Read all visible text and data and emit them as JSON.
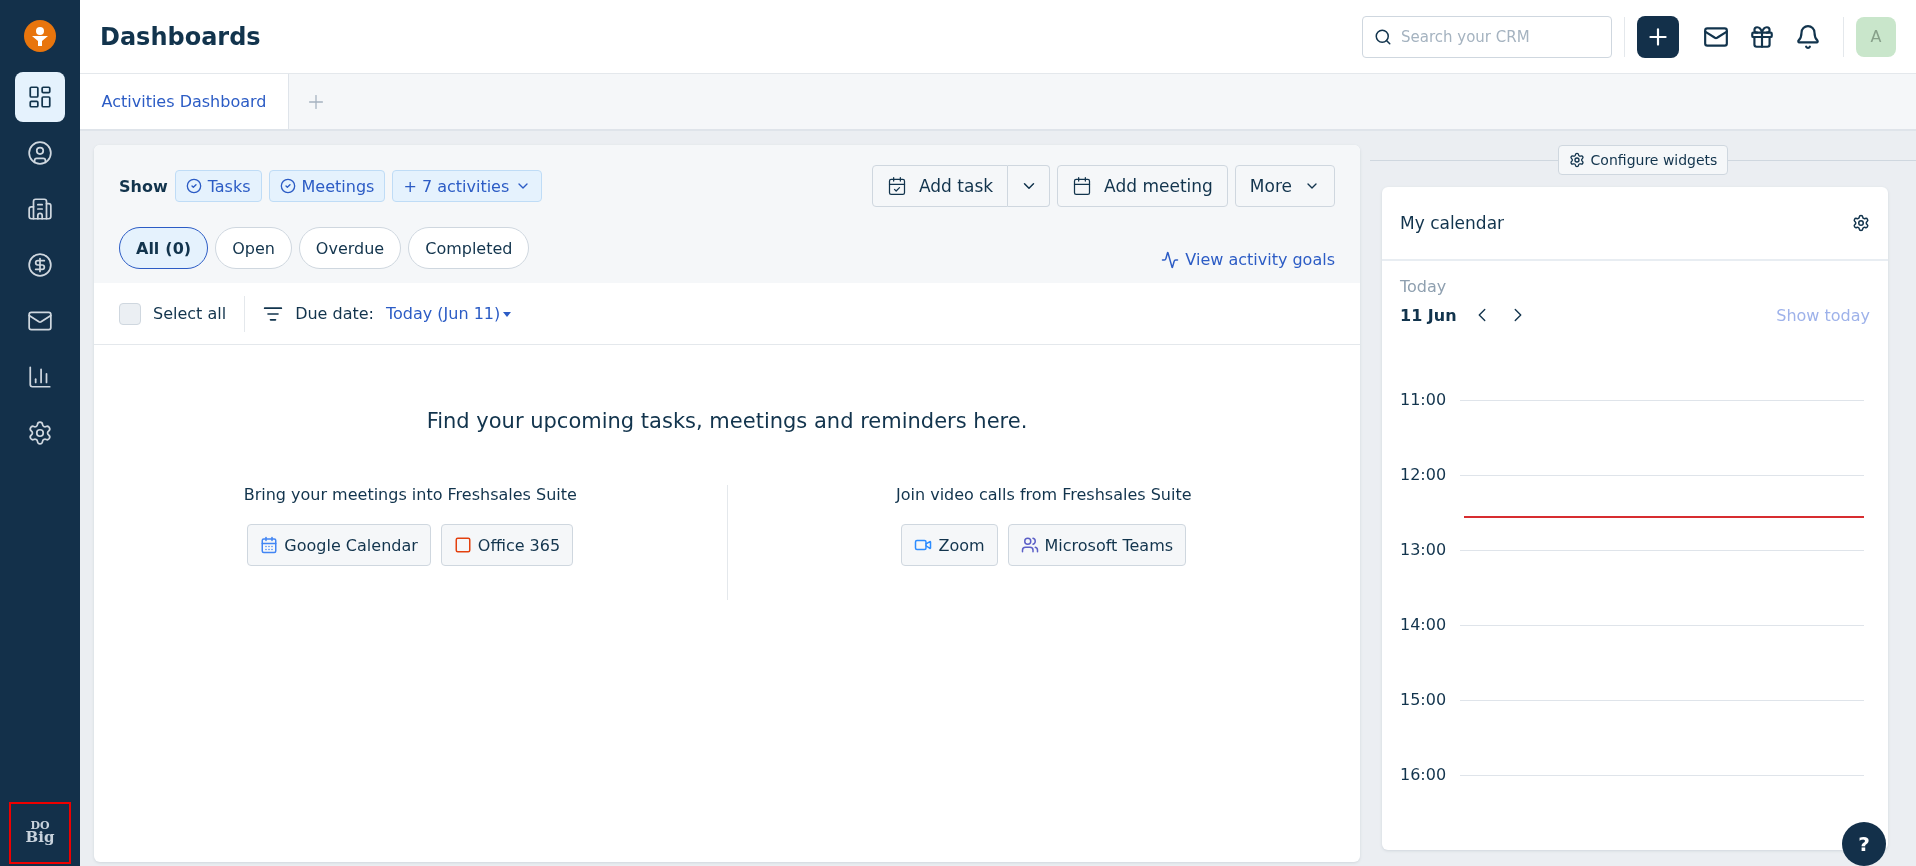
{
  "sidebar": {
    "items": [
      {
        "kind": "dashboards",
        "selected": true
      },
      {
        "kind": "contacts",
        "selected": false
      },
      {
        "kind": "accounts",
        "selected": false
      },
      {
        "kind": "deals",
        "selected": false
      },
      {
        "kind": "mail",
        "selected": false
      },
      {
        "kind": "reports",
        "selected": false
      },
      {
        "kind": "settings",
        "selected": false
      }
    ],
    "logo_text": [
      "DO",
      "Big"
    ]
  },
  "header": {
    "title": "Dashboards",
    "search": {
      "placeholder": "Search your CRM"
    },
    "avatar": "A"
  },
  "tabs": [
    {
      "label": "Activities Dashboard",
      "selected": true
    }
  ],
  "activities": {
    "show_label": "Show",
    "filters": [
      {
        "label": "Tasks",
        "kind": "check"
      },
      {
        "label": "Meetings",
        "kind": "check"
      },
      {
        "label": "+ 7 activities",
        "kind": "dropdown"
      }
    ],
    "actions": [
      {
        "label": "Add task",
        "kind": "task"
      },
      {
        "label": "Add meeting",
        "kind": "meeting"
      },
      {
        "label": "More",
        "kind": "more"
      }
    ],
    "status_tabs": [
      {
        "label": "All",
        "count": "(0)",
        "selected": true
      },
      {
        "label": "Open",
        "selected": false
      },
      {
        "label": "Overdue",
        "selected": false
      },
      {
        "label": "Completed",
        "selected": false
      }
    ],
    "goals_link": "View activity goals",
    "select_all": {
      "label": "Select all",
      "checked": false
    },
    "due_date": {
      "label": "Due date:",
      "value": "Today (Jun 11)"
    },
    "empty": {
      "heading": "Find your upcoming tasks, meetings and reminders here.",
      "columns": [
        {
          "title": "Bring your meetings into Freshsales Suite",
          "buttons": [
            {
              "label": "Google Calendar",
              "kind": "google"
            },
            {
              "label": "Office 365",
              "kind": "office"
            }
          ]
        },
        {
          "title": "Join video calls from Freshsales Suite",
          "buttons": [
            {
              "label": "Zoom",
              "kind": "zoom"
            },
            {
              "label": "Microsoft Teams",
              "kind": "teams"
            }
          ]
        }
      ]
    }
  },
  "widgets": {
    "configure": "Configure widgets",
    "calendar": {
      "title": "My calendar",
      "today_label": "Today",
      "date": "11 Jun",
      "show_today": "Show today",
      "hours": [
        "11:00",
        "12:00",
        "13:00",
        "14:00",
        "15:00",
        "16:00"
      ]
    }
  },
  "help": "?"
}
